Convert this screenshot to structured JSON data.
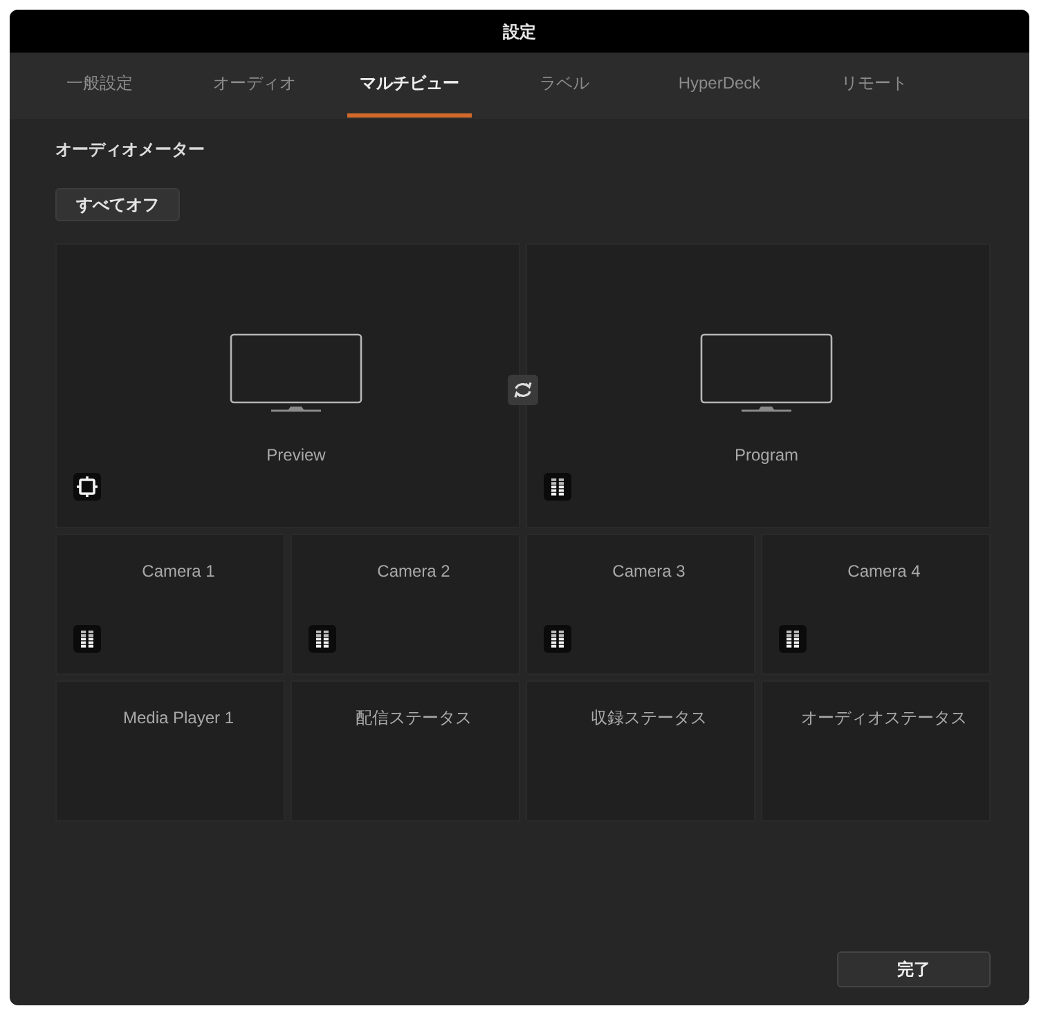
{
  "window": {
    "title": "設定"
  },
  "tabs": [
    {
      "label": "一般設定",
      "selected": false
    },
    {
      "label": "オーディオ",
      "selected": false
    },
    {
      "label": "マルチビュー",
      "selected": true
    },
    {
      "label": "ラベル",
      "selected": false
    },
    {
      "label": "HyperDeck",
      "selected": false
    },
    {
      "label": "リモート",
      "selected": false
    }
  ],
  "audio_meters": {
    "title": "オーディオメーター",
    "all_off_button": "すべてオフ"
  },
  "multiview": {
    "large_views": [
      {
        "label": "Preview",
        "kind": "frame"
      },
      {
        "label": "Program",
        "kind": "meter"
      }
    ],
    "small_views": [
      {
        "label": "Camera 1",
        "kind": "meter"
      },
      {
        "label": "Camera 2",
        "kind": "meter"
      },
      {
        "label": "Camera 3",
        "kind": "meter"
      },
      {
        "label": "Camera 4",
        "kind": "meter"
      },
      {
        "label": "Media Player 1",
        "kind": "plain"
      },
      {
        "label": "配信ステータス",
        "kind": "plain"
      },
      {
        "label": "収録ステータス",
        "kind": "plain"
      },
      {
        "label": "オーディオステータス",
        "kind": "plain"
      }
    ]
  },
  "done_button": "完了"
}
